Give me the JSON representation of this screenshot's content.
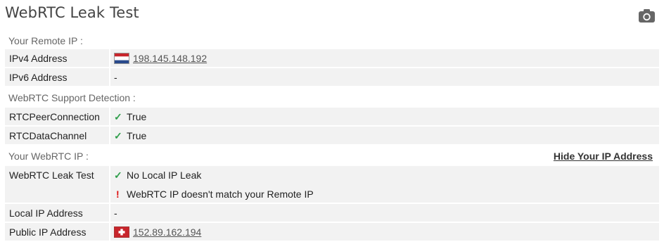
{
  "page": {
    "title": "WebRTC Leak Test",
    "camera_icon": "camera-icon"
  },
  "remote_ip": {
    "heading": "Your Remote IP :",
    "ipv4_label": "IPv4 Address",
    "ipv4_value": "198.145.148.192",
    "ipv4_flag": "netherlands-flag-icon",
    "ipv6_label": "IPv6 Address",
    "ipv6_value": "-"
  },
  "support": {
    "heading": "WebRTC Support Detection :",
    "peer_label": "RTCPeerConnection",
    "peer_value": "True",
    "channel_label": "RTCDataChannel",
    "channel_value": "True"
  },
  "webrtc_ip": {
    "heading": "Your WebRTC IP :",
    "hide_link": "Hide Your IP Address",
    "leak_label": "WebRTC Leak Test",
    "leak_value": "No Local IP Leak",
    "mismatch_value": "WebRTC IP doesn't match your Remote IP",
    "local_label": "Local IP Address",
    "local_value": "-",
    "public_label": "Public IP Address",
    "public_value": "152.89.162.194",
    "public_flag": "switzerland-flag-icon"
  },
  "symbols": {
    "check": "✓",
    "exclamation": "!"
  },
  "colors": {
    "check": "#2e9e4a",
    "warning": "#dd1111",
    "row_bg": "#f2f2f2"
  }
}
